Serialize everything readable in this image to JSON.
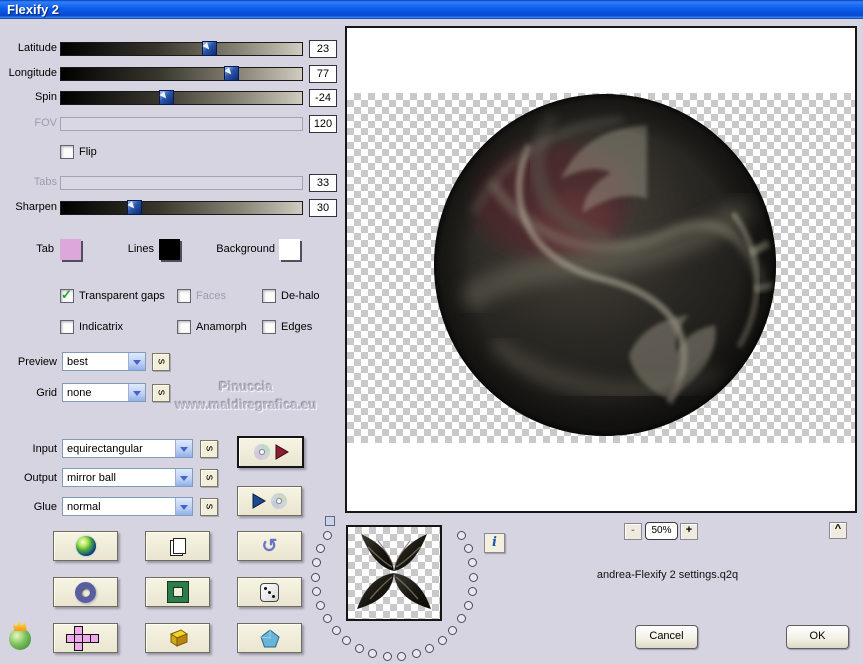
{
  "window": {
    "title": "Flexify 2"
  },
  "sliders": [
    {
      "label": "Latitude",
      "value": "23",
      "disabled": false
    },
    {
      "label": "Longitude",
      "value": "77",
      "disabled": false
    },
    {
      "label": "Spin",
      "value": "-24",
      "disabled": false
    },
    {
      "label": "FOV",
      "value": "120",
      "disabled": true
    },
    {
      "label": "Tabs",
      "value": "33",
      "disabled": true
    },
    {
      "label": "Sharpen",
      "value": "30",
      "disabled": false
    }
  ],
  "flip": {
    "label": "Flip",
    "checked": false
  },
  "swatches": [
    {
      "label": "Tab",
      "color": "#dda7dc"
    },
    {
      "label": "Lines",
      "color": "#000000"
    },
    {
      "label": "Background",
      "color": "#ffffff"
    }
  ],
  "checkboxes": [
    {
      "label": "Transparent gaps",
      "checked": true,
      "disabled": false
    },
    {
      "label": "Faces",
      "checked": false,
      "disabled": true
    },
    {
      "label": "De-halo",
      "checked": false,
      "disabled": false
    },
    {
      "label": "Indicatrix",
      "checked": false,
      "disabled": false
    },
    {
      "label": "Anamorph",
      "checked": false,
      "disabled": false
    },
    {
      "label": "Edges",
      "checked": false,
      "disabled": false
    }
  ],
  "dropdowns": [
    {
      "label": "Preview",
      "value": "best"
    },
    {
      "label": "Grid",
      "value": "none"
    },
    {
      "label": "Input",
      "value": "equirectangular"
    },
    {
      "label": "Output",
      "value": "mirror ball"
    },
    {
      "label": "Glue",
      "value": "normal"
    }
  ],
  "s_label": "s",
  "check_glyph": "✓",
  "watermark": {
    "line1": "Pinuccia",
    "line2": "www.maldiregrafica.eu"
  },
  "zoom": {
    "minus": "-",
    "level": "50%",
    "plus": "+",
    "collapse": "^"
  },
  "info_label": "i",
  "undo_glyph": "↺",
  "filename": "andrea-Flexify 2 settings.q2q",
  "actions": {
    "cancel": "Cancel",
    "ok": "OK"
  }
}
